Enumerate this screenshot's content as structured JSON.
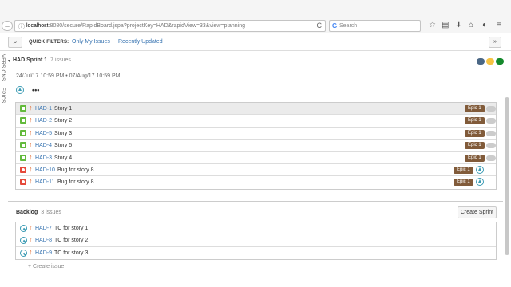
{
  "browser": {
    "url_host": "localhost",
    "url_path": ":8080/secure/RapidBoard.jspa?projectKey=HAD&rapidView=33&view=planning",
    "search_placeholder": "Search",
    "back_glyph": "←",
    "reload_glyph": "C"
  },
  "header": {
    "quick_filters_label": "QUICK FILTERS:",
    "filters": [
      "Only My Issues",
      "Recently Updated"
    ],
    "collapse_glyph": "»"
  },
  "side_tabs": [
    "VERSIONS",
    "EPICS"
  ],
  "sprint": {
    "name": "HAD Sprint 1",
    "count": "7 issues",
    "dates": "24/Jul/17 10:59 PM  •  07/Aug/17 10:59 PM",
    "status_colors": [
      "#4a6785",
      "#f6c342",
      "#14892c"
    ],
    "more_glyph": "•••",
    "issues": [
      {
        "type": "story",
        "key": "HAD-1",
        "summary": "Story 1",
        "epic": "Epic 1",
        "selected": true
      },
      {
        "type": "story",
        "key": "HAD-2",
        "summary": "Story 2",
        "epic": "Epic 1"
      },
      {
        "type": "story",
        "key": "HAD-5",
        "summary": "Story 3",
        "epic": "Epic 1"
      },
      {
        "type": "story",
        "key": "HAD-4",
        "summary": "Story 5",
        "epic": "Epic 1"
      },
      {
        "type": "story",
        "key": "HAD-3",
        "summary": "Story 4",
        "epic": "Epic 1"
      },
      {
        "type": "bug",
        "key": "HAD-10",
        "summary": "Bug for story 8",
        "epic": "Epic 1",
        "linked": true
      },
      {
        "type": "bug",
        "key": "HAD-11",
        "summary": "Bug for story 8",
        "epic": "Epic 1",
        "linked": true
      }
    ]
  },
  "backlog": {
    "name": "Backlog",
    "count": "3 issues",
    "create_sprint": "Create Sprint",
    "create_issue": "+ Create issue",
    "issues": [
      {
        "type": "tc",
        "key": "HAD-7",
        "summary": "TC for story 1"
      },
      {
        "type": "tc",
        "key": "HAD-8",
        "summary": "TC for story 2"
      },
      {
        "type": "tc",
        "key": "HAD-9",
        "summary": "TC for story 3"
      }
    ]
  },
  "colors": {
    "link": "#3572b0",
    "epic": "#815b3a",
    "priority": "#e0662a"
  },
  "icons": [
    "search-icon",
    "star-icon",
    "clipboard-icon",
    "download-icon",
    "home-icon",
    "menu-icon"
  ]
}
